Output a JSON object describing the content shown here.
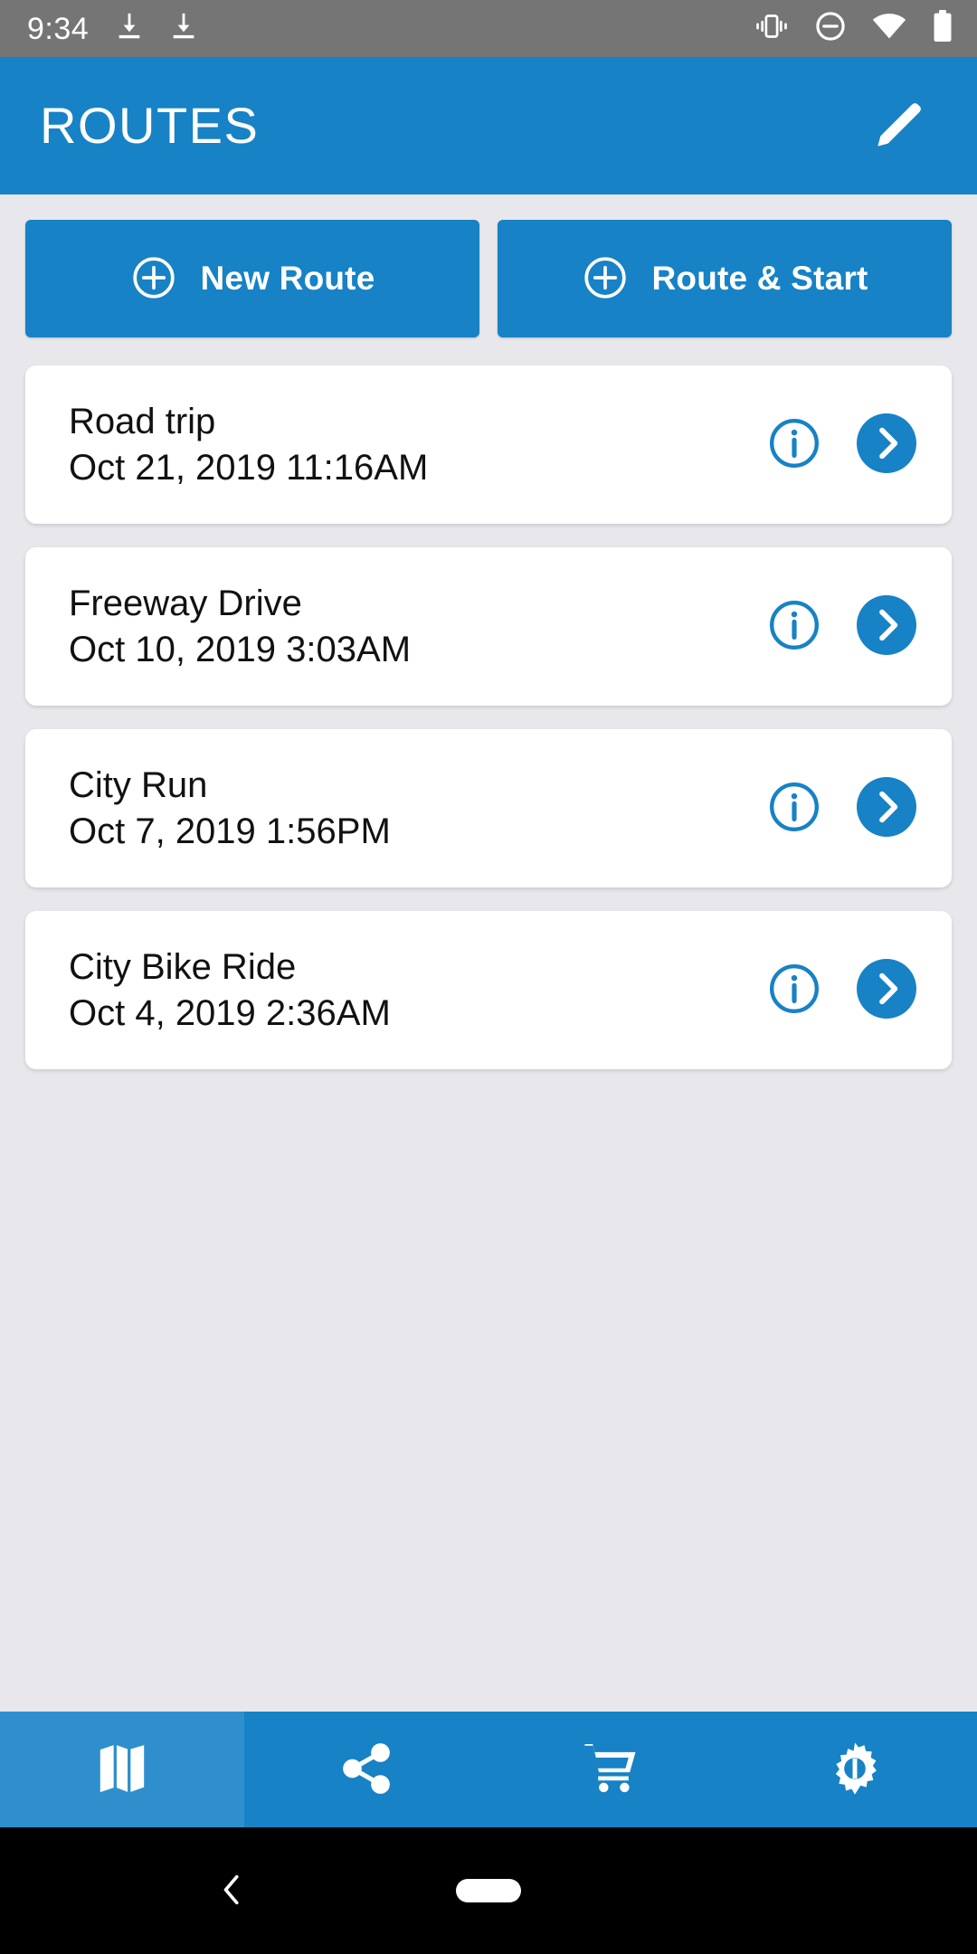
{
  "status_bar": {
    "clock": "9:34",
    "left_icons": [
      "download-icon",
      "download-icon"
    ],
    "right_icons": [
      "vibrate-icon",
      "do-not-disturb-icon",
      "wifi-icon",
      "battery-icon"
    ],
    "background_color": "#757575"
  },
  "app_bar": {
    "title": "ROUTES",
    "edit_icon": "pencil-icon",
    "background_color": "#1782c5",
    "text_color": "#ffffff"
  },
  "actions": {
    "new_route": {
      "label": "New Route",
      "icon": "plus-circle-icon"
    },
    "route_and_start": {
      "label": "Route & Start",
      "icon": "plus-circle-icon"
    },
    "button_color": "#1782c5"
  },
  "routes": [
    {
      "name": "Road trip",
      "date": "Oct 21, 2019 11:16AM",
      "info_icon": "info-circle-icon",
      "open_icon": "chevron-right-icon"
    },
    {
      "name": "Freeway Drive",
      "date": "Oct 10, 2019 3:03AM",
      "info_icon": "info-circle-icon",
      "open_icon": "chevron-right-icon"
    },
    {
      "name": "City Run",
      "date": "Oct 7, 2019 1:56PM",
      "info_icon": "info-circle-icon",
      "open_icon": "chevron-right-icon"
    },
    {
      "name": "City Bike Ride",
      "date": "Oct 4, 2019 2:36AM",
      "info_icon": "info-circle-icon",
      "open_icon": "chevron-right-icon"
    }
  ],
  "bottom_nav": {
    "items": [
      {
        "icon": "map-icon",
        "selected": true
      },
      {
        "icon": "share-icon",
        "selected": false
      },
      {
        "icon": "cart-icon",
        "selected": false
      },
      {
        "icon": "settings-gear-icon",
        "selected": false
      }
    ],
    "background_color": "#1782c5",
    "selected_color": "#2e8fcc"
  },
  "android_nav": {
    "back_icon": "back-chevron-icon",
    "home_icon": "home-pill-icon",
    "background_color": "#000000"
  },
  "theme": {
    "accent": "#1782c5",
    "page_background": "#e8e7ec",
    "card_background": "#ffffff"
  }
}
